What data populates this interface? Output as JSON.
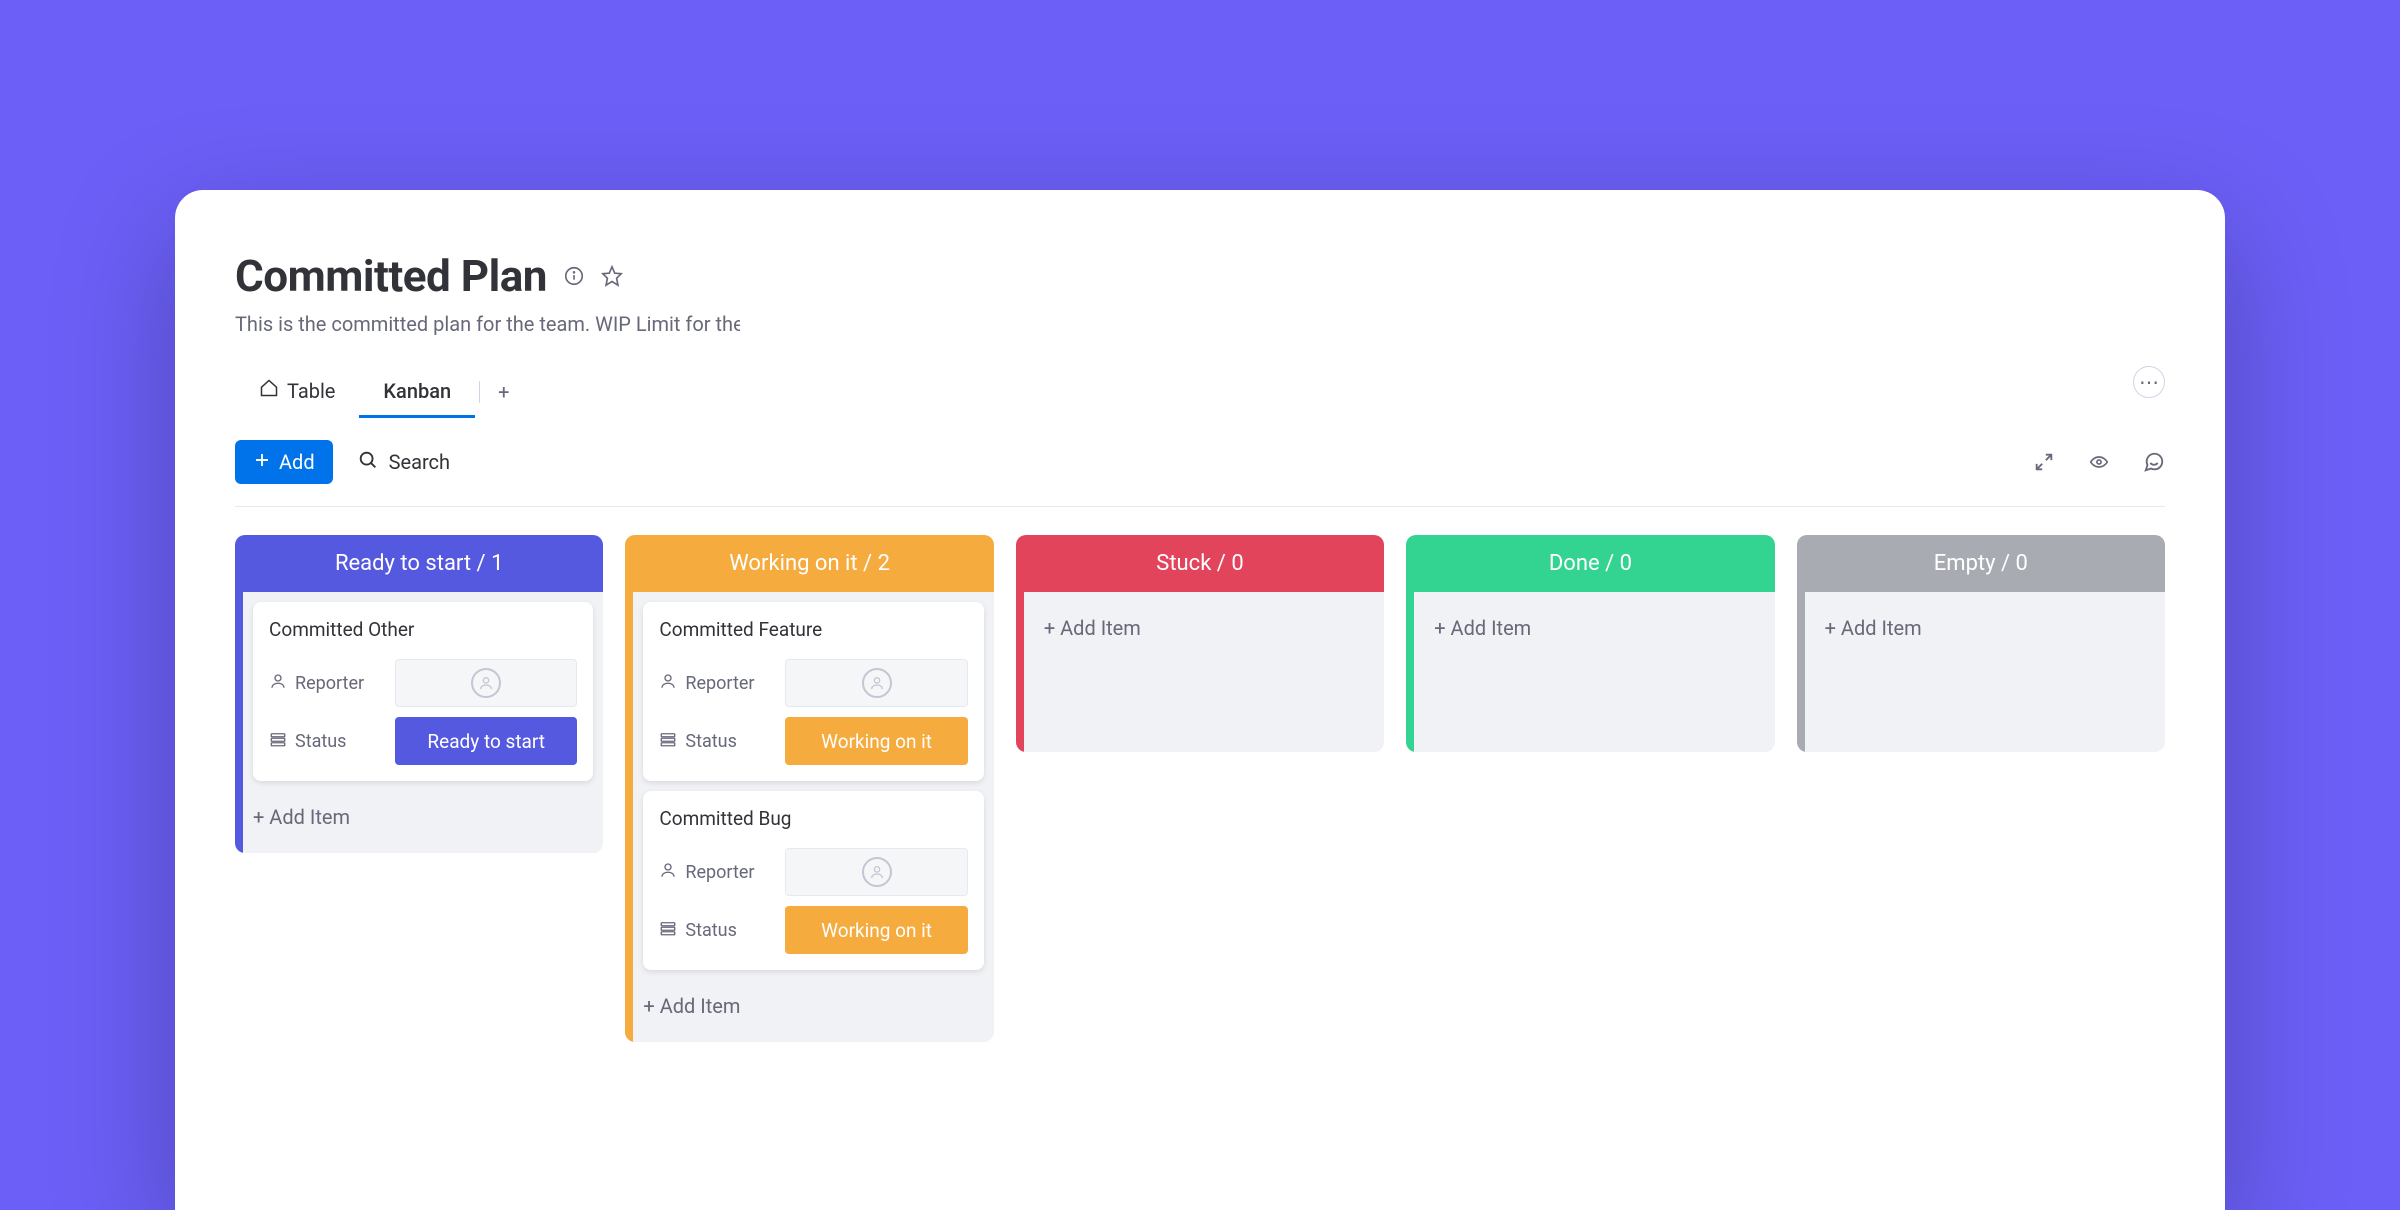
{
  "header": {
    "title": "Committed Plan",
    "subtitle": "This is the committed plan for the team. WIP Limit for the",
    "tabs": [
      {
        "label": "Table",
        "icon": "home"
      },
      {
        "label": "Kanban",
        "icon": ""
      }
    ],
    "active_tab": "Kanban"
  },
  "toolbar": {
    "add_label": "Add",
    "search_label": "Search"
  },
  "columns": [
    {
      "id": "ready",
      "title_text": "Ready to start / 1",
      "title": "Ready to start",
      "count": 1,
      "color": "#5559df",
      "add_item_label": "+ Add Item",
      "cards": [
        {
          "title": "Committed Other",
          "reporter_label": "Reporter",
          "status_label": "Status",
          "status_value": "Ready to start",
          "status_color": "#5559df"
        }
      ]
    },
    {
      "id": "working",
      "title_text": "Working on it / 2",
      "title": "Working on it",
      "count": 2,
      "color": "#f5ab3d",
      "add_item_label": "+ Add Item",
      "cards": [
        {
          "title": "Committed Feature",
          "reporter_label": "Reporter",
          "status_label": "Status",
          "status_value": "Working on it",
          "status_color": "#f5ab3d"
        },
        {
          "title": "Committed Bug",
          "reporter_label": "Reporter",
          "status_label": "Status",
          "status_value": "Working on it",
          "status_color": "#f5ab3d"
        }
      ]
    },
    {
      "id": "stuck",
      "title_text": "Stuck / 0",
      "title": "Stuck",
      "count": 0,
      "color": "#e2445c",
      "add_item_label": "+ Add Item",
      "cards": []
    },
    {
      "id": "done",
      "title_text": "Done / 0",
      "title": "Done",
      "count": 0,
      "color": "#33d391",
      "add_item_label": "+ Add Item",
      "cards": []
    },
    {
      "id": "empty",
      "title_text": "Empty / 0",
      "title": "Empty",
      "count": 0,
      "color": "#a9abb3",
      "add_item_label": "+ Add Item",
      "cards": []
    }
  ]
}
